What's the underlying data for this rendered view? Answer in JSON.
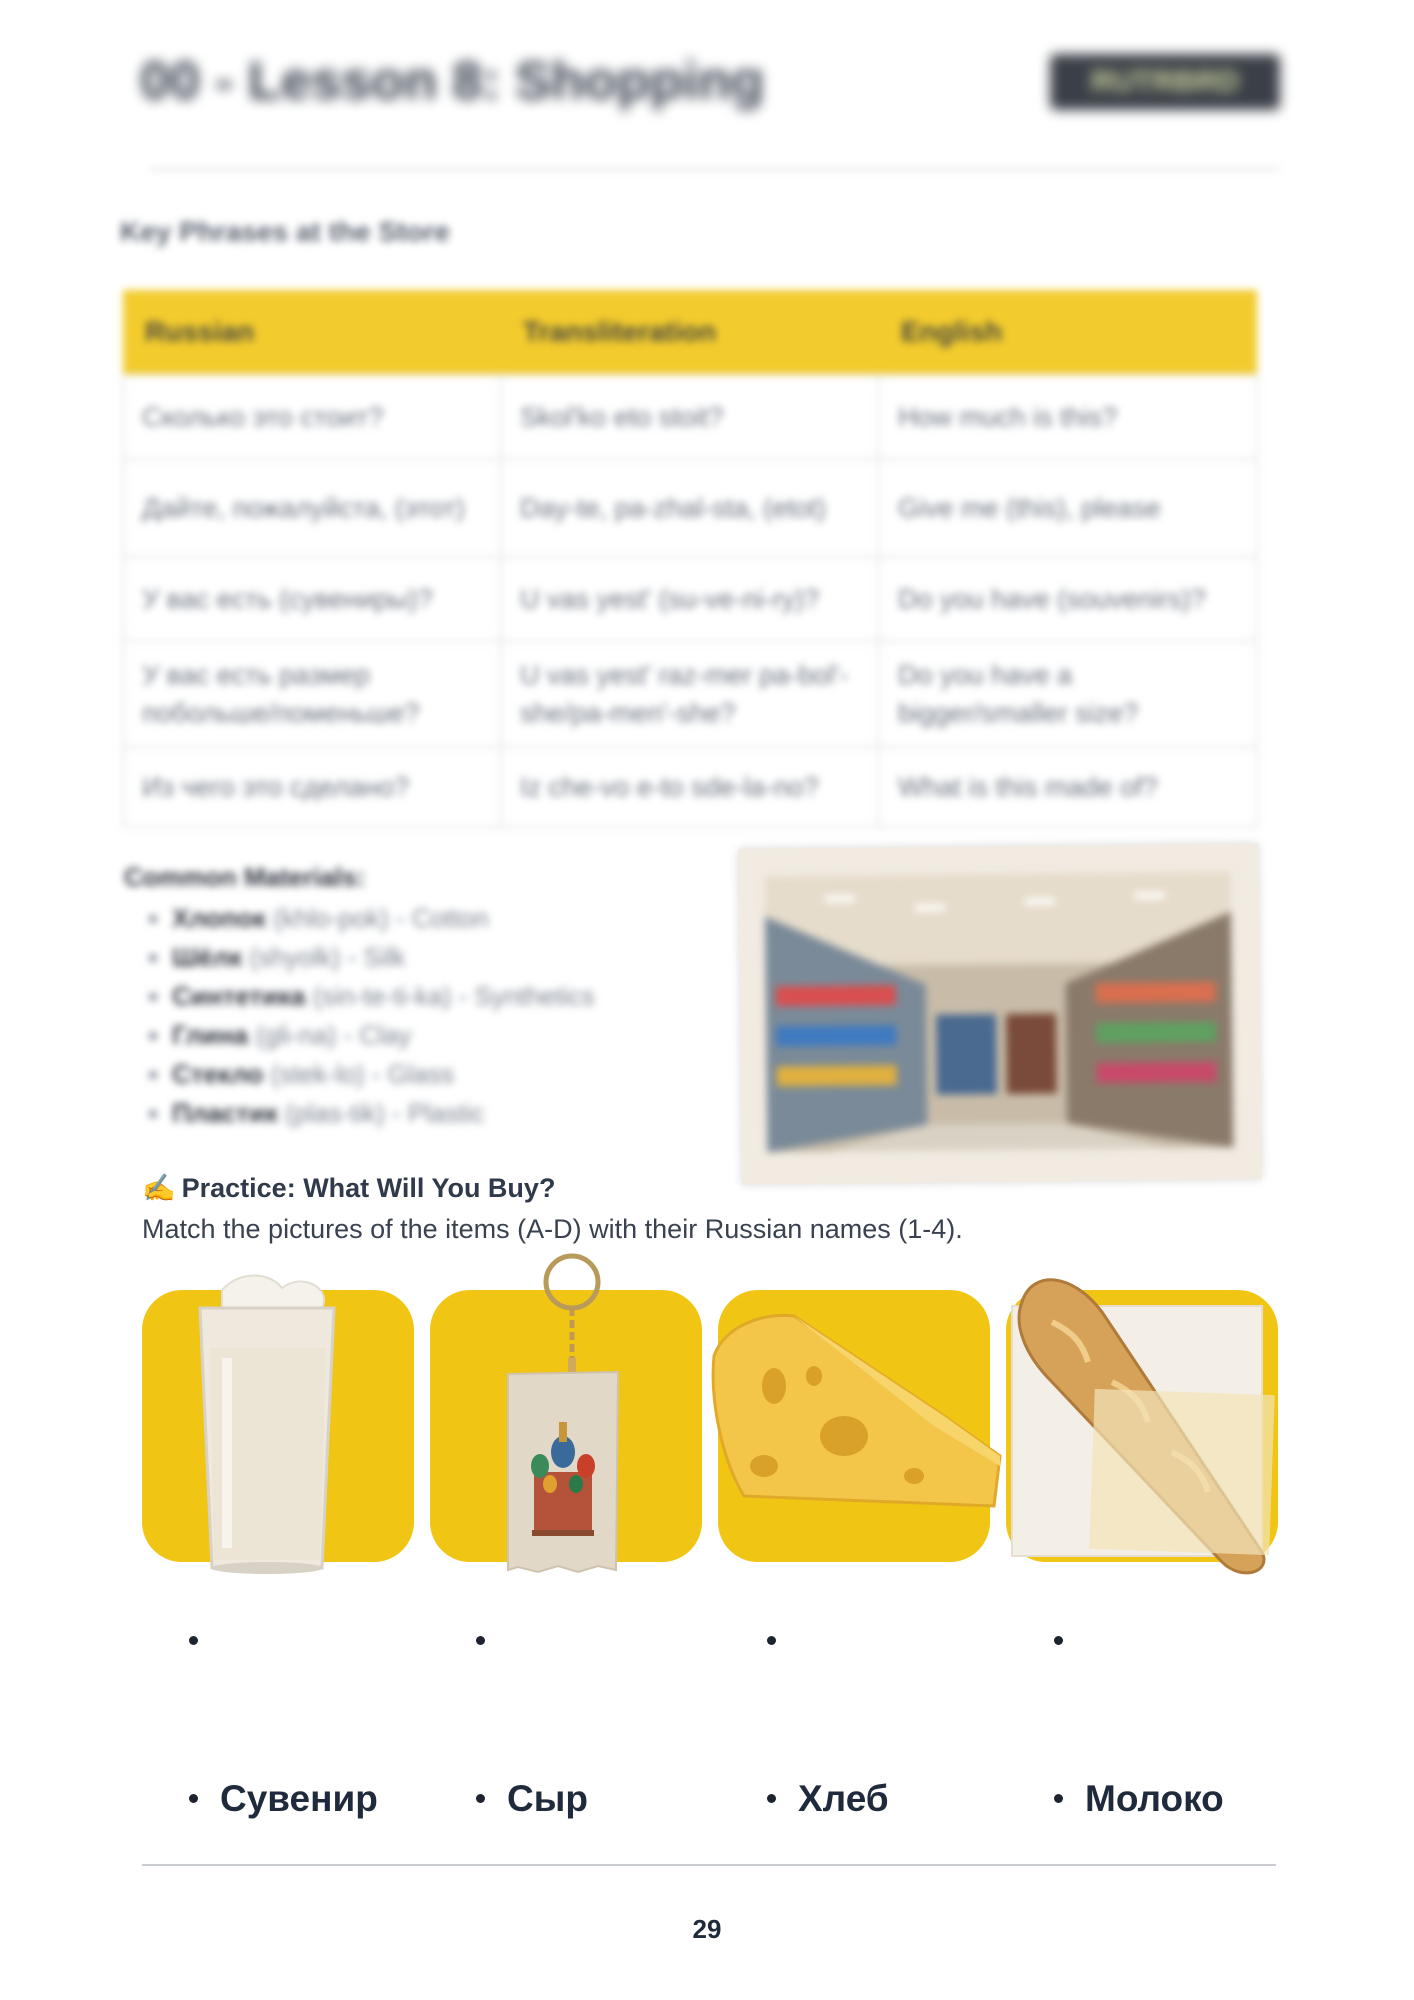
{
  "header": {
    "title": "00 - Lesson 8: Shopping",
    "badge": "RUTRBRD"
  },
  "key_phrases": {
    "title": "Key Phrases at the Store",
    "columns": [
      "Russian",
      "Transliteration",
      "English"
    ],
    "rows": [
      [
        "Сколько это стоит?",
        "Skol'ko eto stoit?",
        "How much is this?"
      ],
      [
        "Дайте, пожалуйста, (этот)",
        "Day-te, pa-zhal-sta, (etot)",
        "Give me (this), please"
      ],
      [
        "У вас есть (сувениры)?",
        "U vas yest' (su-ve-ni-ry)?",
        "Do you have (souvenirs)?"
      ],
      [
        "У вас есть размер побольше/поменьше?",
        "U vas yest' raz-mer pa-bol'-she/pa-men'-she?",
        "Do you have a bigger/smaller size?"
      ],
      [
        "Из чего это сделано?",
        "Iz che-vo e-to sde-la-no?",
        "What is this made of?"
      ]
    ]
  },
  "materials": {
    "title": "Common Materials:",
    "items": [
      {
        "ru": "Хлопок",
        "translit": "(khlo-pok)",
        "en": "- Cotton"
      },
      {
        "ru": "Шёлк",
        "translit": "(shyolk)",
        "en": "- Silk"
      },
      {
        "ru": "Синтетика",
        "translit": "(sin-te-ti-ka)",
        "en": "- Synthetics"
      },
      {
        "ru": "Глина",
        "translit": "(gli-na)",
        "en": "- Clay"
      },
      {
        "ru": "Стекло",
        "translit": "(stek-lo)",
        "en": "- Glass"
      },
      {
        "ru": "Пластик",
        "translit": "(plas-tik)",
        "en": "- Plastic"
      }
    ]
  },
  "practice": {
    "icon": "✍",
    "title": "Practice: What Will You Buy?",
    "instruction": "Match the pictures of the items (A-D) with their Russian names (1-4).",
    "items": [
      {
        "icon": "milk-glass-icon"
      },
      {
        "icon": "keychain-souvenir-icon"
      },
      {
        "icon": "cheese-icon"
      },
      {
        "icon": "baguette-icon"
      }
    ],
    "answers": [
      "Сувенир",
      "Сыр",
      "Хлеб",
      "Молоко"
    ]
  },
  "colors": {
    "accent": "#f0c514",
    "text_dark": "#1f2b3c"
  },
  "page_number": "29"
}
